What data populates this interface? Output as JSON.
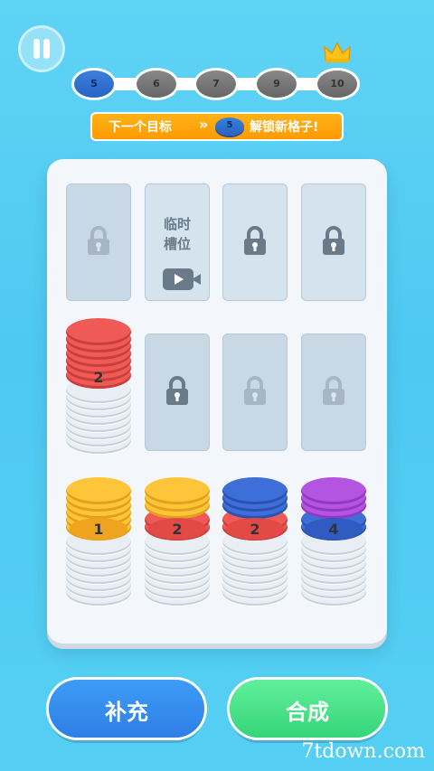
{
  "hud": {
    "pause_icon": "pause-icon"
  },
  "progress": {
    "levels": [
      "5",
      "6",
      "7",
      "9",
      "10"
    ],
    "active_index": 0,
    "crown_icon": "crown-icon"
  },
  "banner": {
    "text_before": "下一个目标",
    "arrows": "»",
    "target": "5",
    "text_after": "解锁新格子!"
  },
  "board": {
    "temp_slot_text_line1": "临时",
    "temp_slot_text_line2": "槽位",
    "stack_labels": {
      "col1_row2": "2",
      "col1_row3": "1",
      "col2_row3": "2",
      "col3_row3": "2",
      "col4_row3": "4"
    }
  },
  "buttons": {
    "refill": "补充",
    "merge": "合成"
  },
  "watermark": {
    "text": "7tdown.com"
  },
  "colors": {
    "red": "#ef5a56",
    "yellow": "#ffc53a",
    "blue": "#3e6ed8",
    "purple": "#b355e0",
    "white": "#e8eef4"
  }
}
